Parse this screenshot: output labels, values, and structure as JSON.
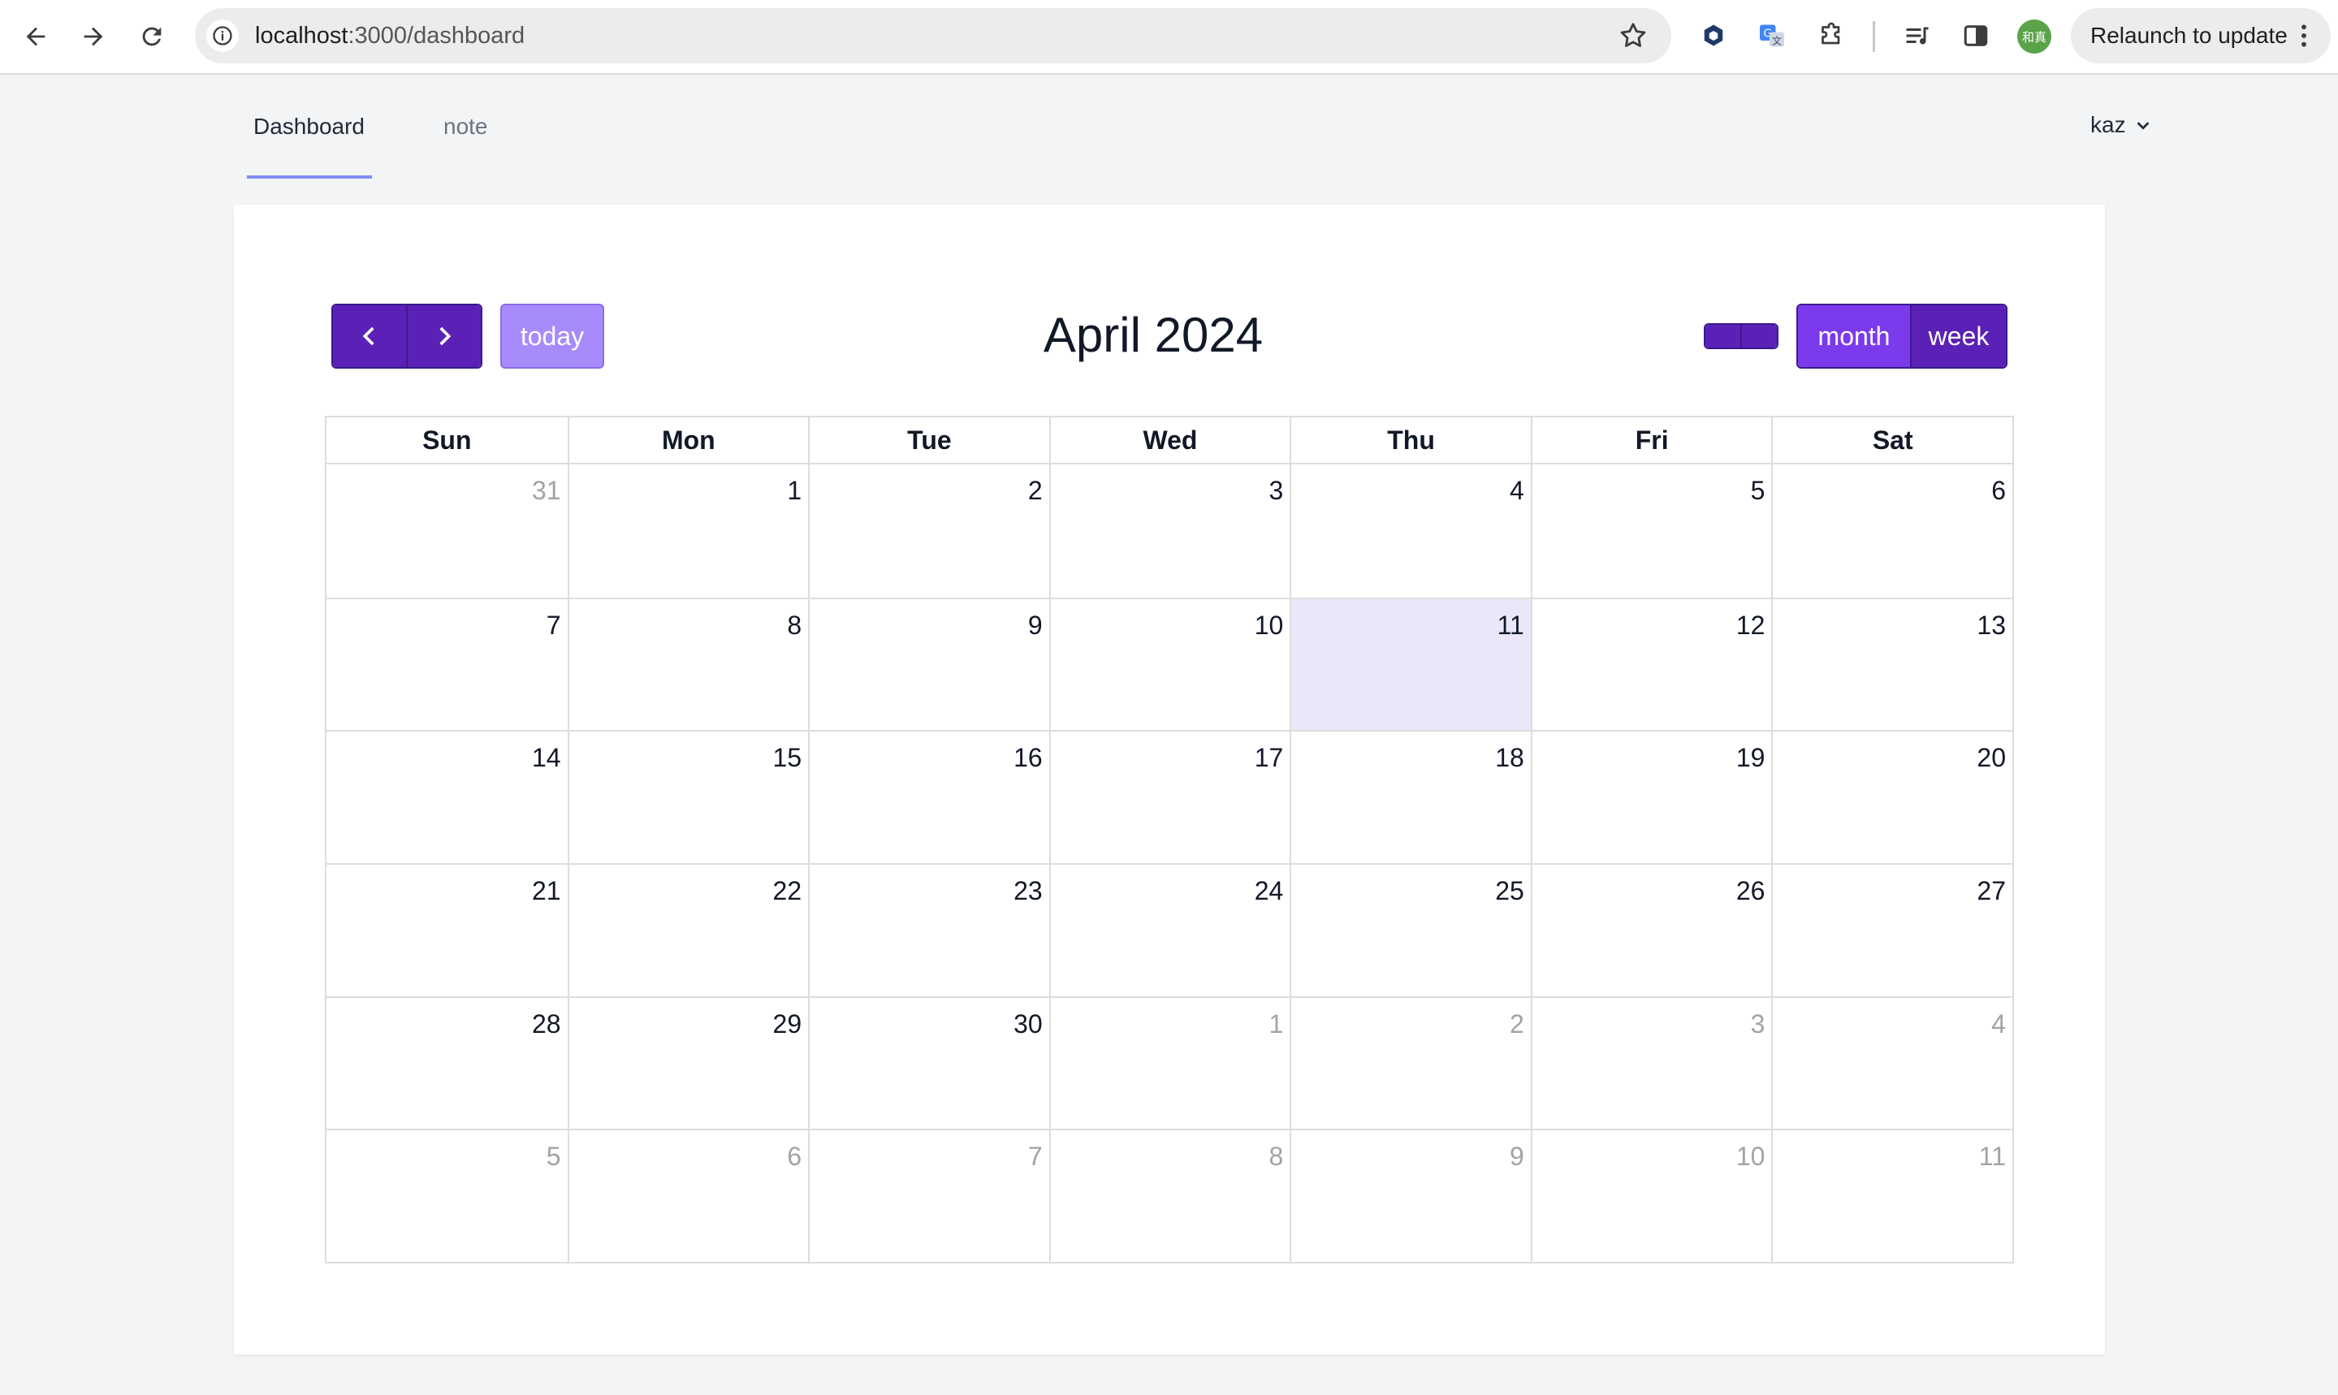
{
  "browser": {
    "url_host": "localhost",
    "url_path": ":3000/dashboard",
    "profile_initials": "和真",
    "relaunch_label": "Relaunch to update",
    "icons": [
      "back-icon",
      "forward-icon",
      "reload-icon",
      "site-info-icon",
      "bookmark-star-icon",
      "extension-hexagon-icon",
      "translate-icon",
      "extensions-puzzle-icon",
      "reading-list-icon",
      "side-panel-icon",
      "more-vert-icon"
    ]
  },
  "nav": {
    "tabs": [
      {
        "label": "Dashboard",
        "active": true
      },
      {
        "label": "note",
        "active": false
      }
    ],
    "user": "kaz"
  },
  "calendar": {
    "title": "April 2024",
    "today_label": "today",
    "view_month_label": "month",
    "view_week_label": "week",
    "active_view": "month",
    "weekdays": [
      "Sun",
      "Mon",
      "Tue",
      "Wed",
      "Thu",
      "Fri",
      "Sat"
    ],
    "days": [
      {
        "n": "31",
        "other": true
      },
      {
        "n": "1"
      },
      {
        "n": "2"
      },
      {
        "n": "3"
      },
      {
        "n": "4"
      },
      {
        "n": "5"
      },
      {
        "n": "6"
      },
      {
        "n": "7"
      },
      {
        "n": "8"
      },
      {
        "n": "9"
      },
      {
        "n": "10"
      },
      {
        "n": "11",
        "today": true
      },
      {
        "n": "12"
      },
      {
        "n": "13"
      },
      {
        "n": "14"
      },
      {
        "n": "15"
      },
      {
        "n": "16"
      },
      {
        "n": "17"
      },
      {
        "n": "18"
      },
      {
        "n": "19"
      },
      {
        "n": "20"
      },
      {
        "n": "21"
      },
      {
        "n": "22"
      },
      {
        "n": "23"
      },
      {
        "n": "24"
      },
      {
        "n": "25"
      },
      {
        "n": "26"
      },
      {
        "n": "27"
      },
      {
        "n": "28"
      },
      {
        "n": "29"
      },
      {
        "n": "30"
      },
      {
        "n": "1",
        "other": true
      },
      {
        "n": "2",
        "other": true
      },
      {
        "n": "3",
        "other": true
      },
      {
        "n": "4",
        "other": true
      },
      {
        "n": "5",
        "other": true
      },
      {
        "n": "6",
        "other": true
      },
      {
        "n": "7",
        "other": true
      },
      {
        "n": "8",
        "other": true
      },
      {
        "n": "9",
        "other": true
      },
      {
        "n": "10",
        "other": true
      },
      {
        "n": "11",
        "other": true
      }
    ],
    "colors": {
      "primary": "#5b21b6",
      "active_view": "#7c3aed",
      "today_button": "#a78bfa",
      "today_cell": "#ebe7fb",
      "tab_underline": "#818cf8"
    }
  }
}
